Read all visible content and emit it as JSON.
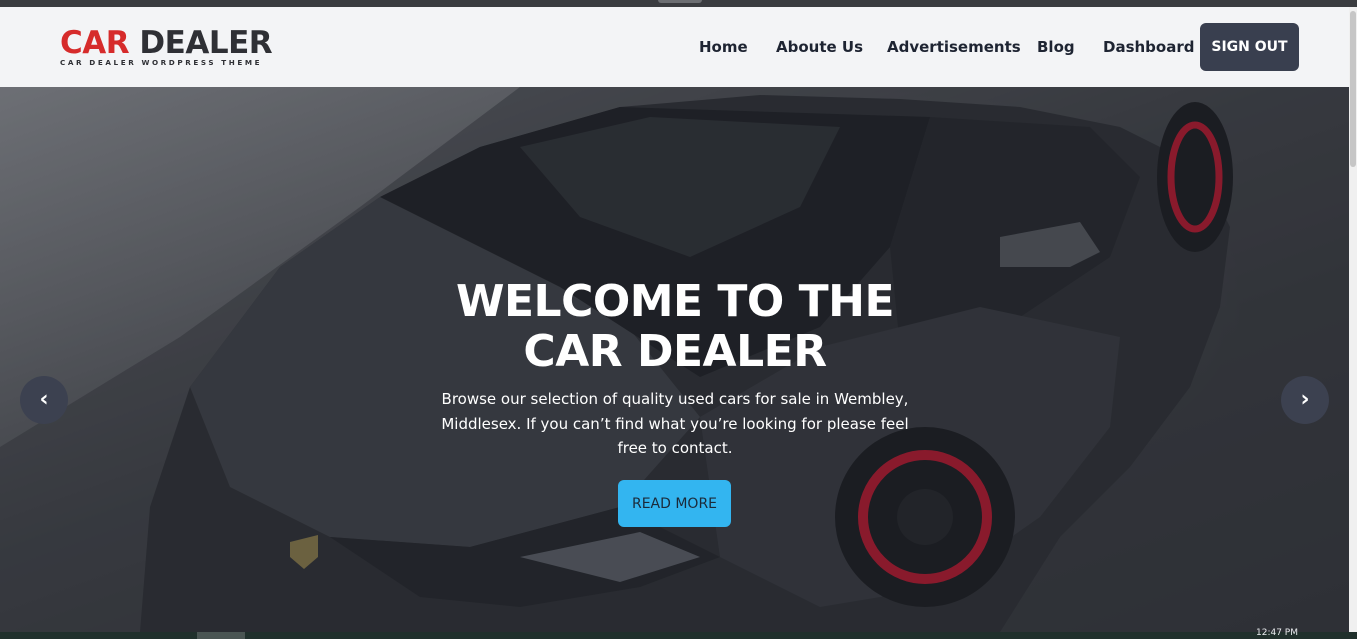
{
  "brand": {
    "logo_car": "CAR",
    "logo_dealer": "DEALER",
    "tagline": "CAR DEALER WORDPRESS THEME",
    "accent_color": "#d62b2b"
  },
  "nav": {
    "home": "Home",
    "about": "Aboute Us",
    "ads": "Advertisements",
    "blog": "Blog",
    "dashboard": "Dashboard",
    "signout": "SIGN OUT",
    "signout_color": "#393f4f"
  },
  "hero": {
    "title_line1": "WELCOME TO THE",
    "title_line2": "CAR DEALER",
    "text": "Browse our selection of quality used cars for sale in Wembley, Middlesex. If you can’t find what you’re looking for please feel free to contact.",
    "cta": "READ MORE",
    "cta_color": "#33b5f0",
    "prev_icon": "‹",
    "next_icon": "›"
  },
  "taskbar": {
    "clock": "12:47 PM"
  }
}
